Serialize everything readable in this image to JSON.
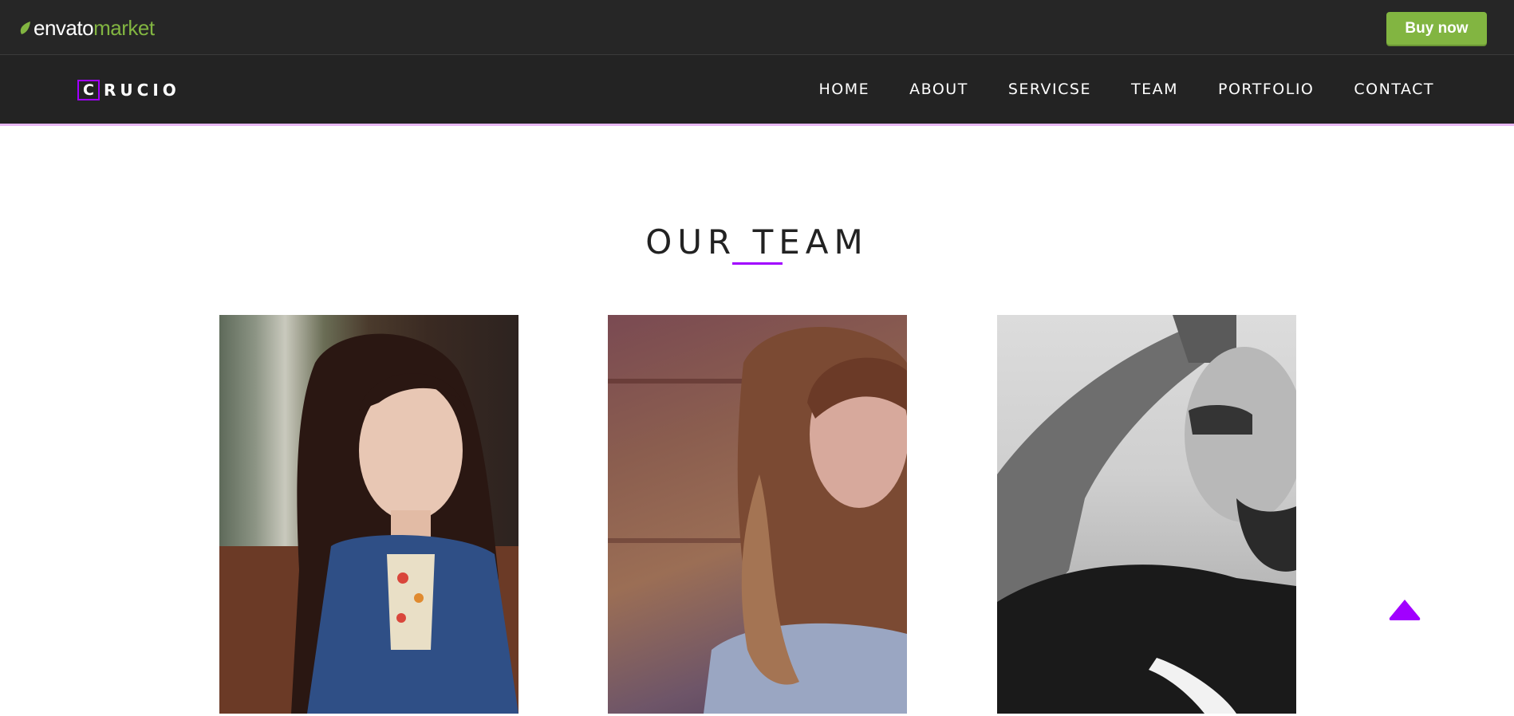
{
  "envato_bar": {
    "logo_brand": "envato",
    "logo_market": "market",
    "buy_label": "Buy now",
    "accent_color": "#82b541"
  },
  "navbar": {
    "logo_letter": "C",
    "logo_rest": "RUCIO",
    "accent_color": "#a100ff",
    "links": [
      {
        "label": "HOME"
      },
      {
        "label": "ABOUT"
      },
      {
        "label": "SERVICSE"
      },
      {
        "label": "TEAM"
      },
      {
        "label": "PORTFOLIO"
      },
      {
        "label": "CONTACT"
      }
    ]
  },
  "team": {
    "title": "OUR TEAM",
    "members": [
      {
        "photo": "woman-denim-jacket-photo"
      },
      {
        "photo": "woman-long-hair-photo"
      },
      {
        "photo": "man-glasses-bw-photo"
      }
    ]
  },
  "scroll_top": {
    "icon": "triangle-up-icon"
  }
}
